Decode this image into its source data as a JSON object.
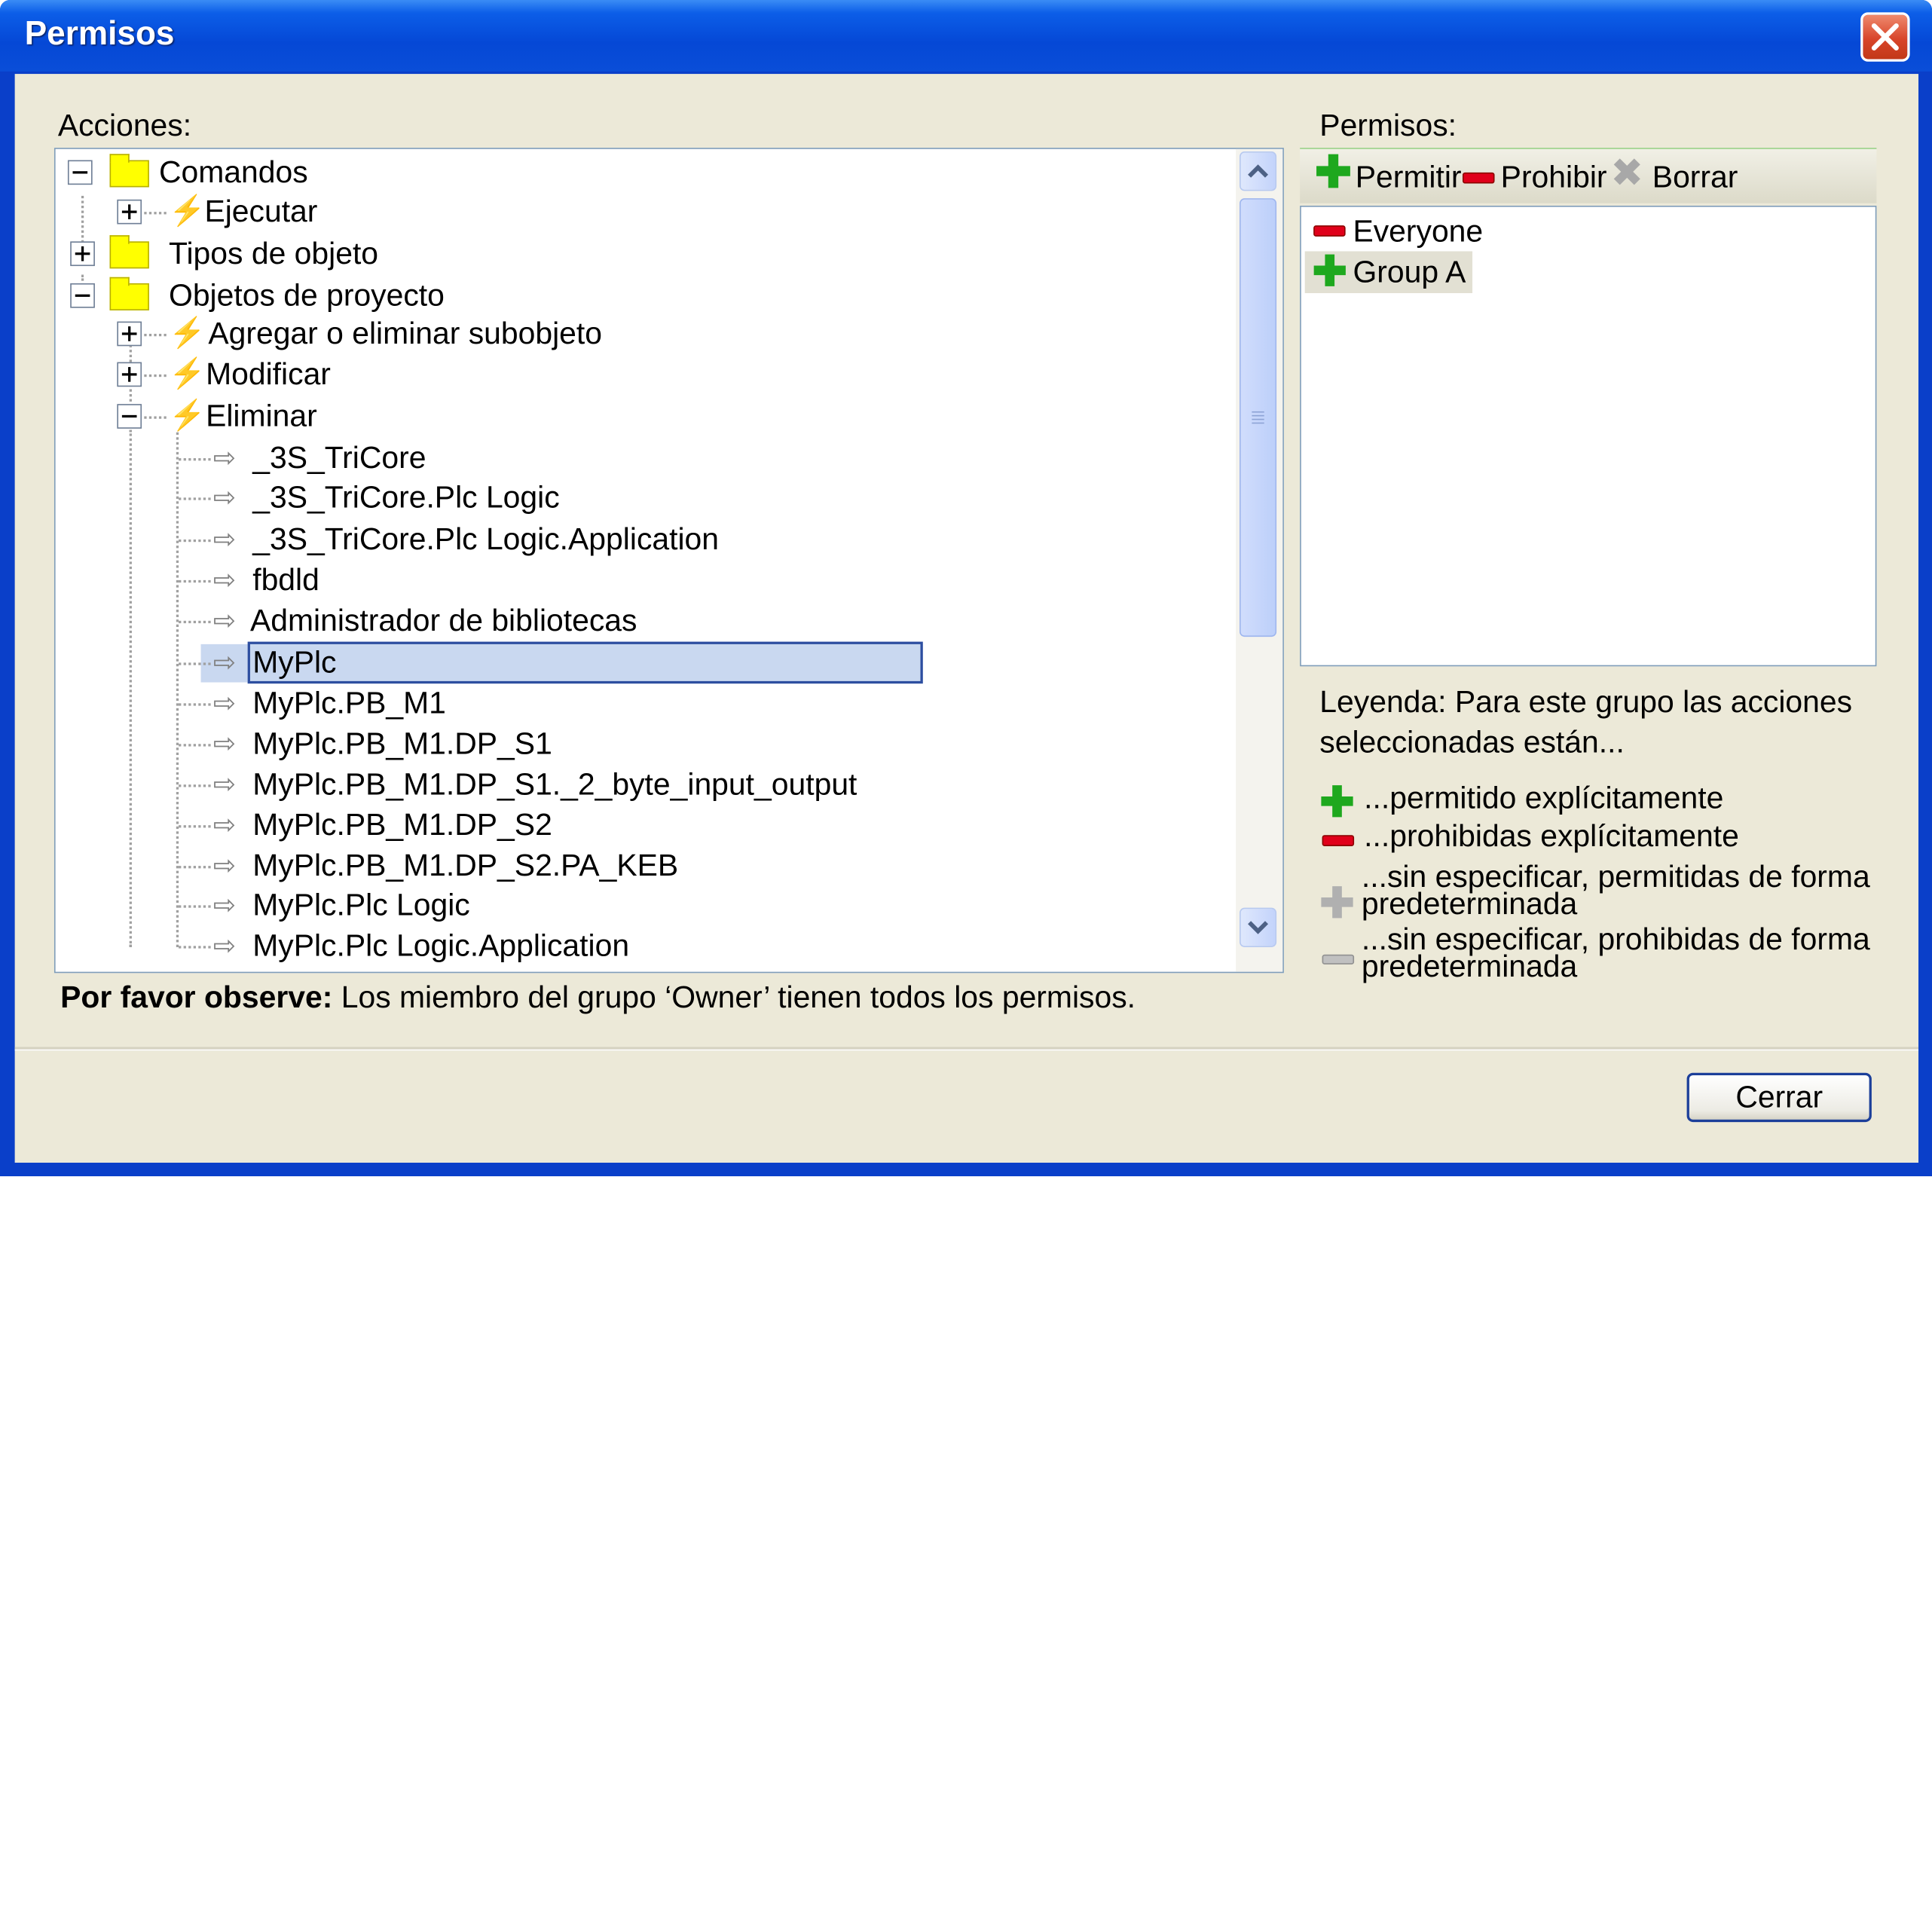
{
  "window": {
    "title": "Permisos"
  },
  "actions": {
    "label": "Acciones:",
    "tree": {
      "comandos": "Comandos",
      "ejecutar": "Ejecutar",
      "tipos": "Tipos de objeto",
      "objetos": "Objetos de proyecto",
      "agregar": "Agregar o eliminar subobjeto",
      "modificar": "Modificar",
      "eliminar": "Eliminar",
      "leaves": [
        "_3S_TriCore",
        "_3S_TriCore.Plc Logic",
        "_3S_TriCore.Plc Logic.Application",
        "fbdld",
        "Administrador de bibliotecas",
        "MyPlc",
        "MyPlc.PB_M1",
        "MyPlc.PB_M1.DP_S1",
        "MyPlc.PB_M1.DP_S1._2_byte_input_output",
        "MyPlc.PB_M1.DP_S2",
        "MyPlc.PB_M1.DP_S2.PA_KEB",
        "MyPlc.Plc Logic",
        "MyPlc.Plc Logic.Application"
      ],
      "selected": "MyPlc"
    }
  },
  "permissions": {
    "label": "Permisos:",
    "toolbar": {
      "permit": "Permitir",
      "deny": "Prohibir",
      "clear": "Borrar"
    },
    "groups": [
      "Everyone",
      "Group A"
    ]
  },
  "legend": {
    "line1": "Leyenda: Para este grupo las acciones",
    "line2": "seleccionadas están...",
    "explicit_allowed": "...permitido explícitamente",
    "explicit_denied": "...prohibidas explícitamente",
    "default_allowed_1": "...sin especificar, permitidas de forma",
    "default_allowed_2": "predeterminada",
    "default_denied_1": "...sin especificar, prohibidas de forma",
    "default_denied_2": "predeterminada"
  },
  "note": {
    "bold": "Por favor observe:",
    "text": " Los miembro del grupo ‘Owner’ tienen todos los permisos."
  },
  "buttons": {
    "close": "Cerrar"
  }
}
